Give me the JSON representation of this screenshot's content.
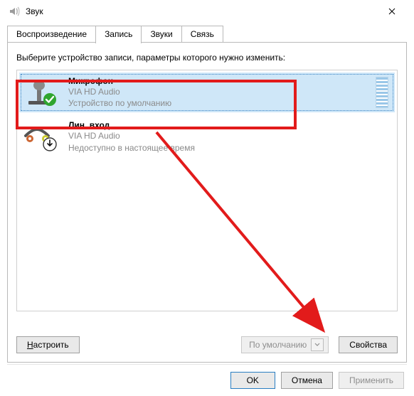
{
  "window": {
    "title": "Звук"
  },
  "tabs": {
    "playback": "Воспроизведение",
    "recording": "Запись",
    "sounds": "Звуки",
    "communications": "Связь"
  },
  "instruction": "Выберите устройство записи, параметры которого нужно изменить:",
  "devices": [
    {
      "name": "Микрофон",
      "driver": "VIA HD Audio",
      "status": "Устройство по умолчанию",
      "selected": true,
      "level_visible": true,
      "badge": "check"
    },
    {
      "name": "Лин. вход",
      "driver": "VIA HD Audio",
      "status": "Недоступно в настоящее время",
      "selected": false,
      "level_visible": false,
      "badge": "down"
    }
  ],
  "buttons": {
    "configure": "Настроить",
    "set_default": "По умолчанию",
    "properties": "Свойства",
    "ok": "OK",
    "cancel": "Отмена",
    "apply": "Применить"
  }
}
